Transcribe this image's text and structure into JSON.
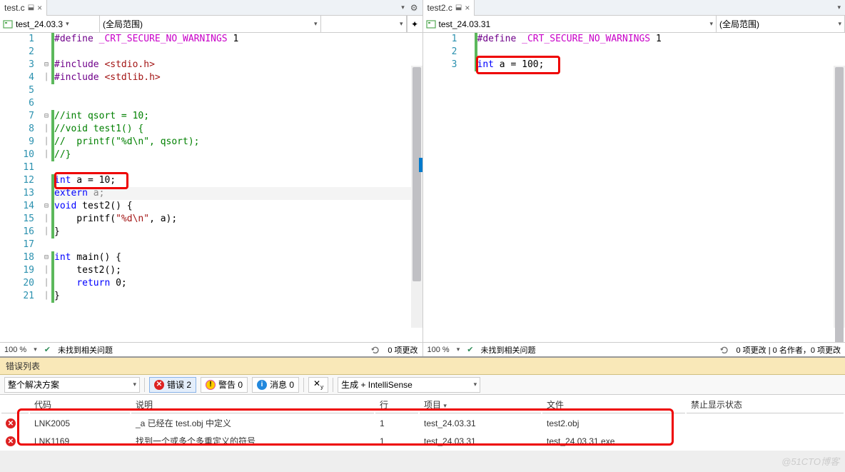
{
  "left": {
    "tab": "test.c",
    "scope1": "test_24.03.3",
    "scope2": "(全局范围)",
    "zoom": "100 %",
    "status_ok": "未找到相关问题",
    "status_changes": "0 项更改",
    "lines": {
      "l1": {
        "pre": "#define ",
        "macro": "_CRT_SECURE_NO_WARNINGS",
        "post": " 1"
      },
      "l3a": "#include ",
      "l3b": "<stdio.h>",
      "l4a": "#include ",
      "l4b": "<stdlib.h>",
      "l7": "//int qsort = 10;",
      "l8": "//void test1() {",
      "l9": "//  printf(\"%d\\n\", qsort);",
      "l10": "//}",
      "l12a": "int",
      "l12b": " a = 10;",
      "l13a": "extern",
      "l13b": " a;",
      "l14a": "void",
      "l14b": " test2() {",
      "l15a": "    printf(",
      "l15b": "\"%d\\n\"",
      "l15c": ", a);",
      "l16": "}",
      "l18a": "int",
      "l18b": " main() {",
      "l19": "    test2();",
      "l20a": "    ",
      "l20b": "return",
      "l20c": " 0;",
      "l21": "}"
    }
  },
  "right": {
    "tab": "test2.c",
    "scope1": "test_24.03.31",
    "scope2": "(全局范围)",
    "zoom": "100 %",
    "status_ok": "未找到相关问题",
    "status_changes": "0 项更改 | 0 名作者，0 项更改",
    "lines": {
      "l1": {
        "pre": "#define ",
        "macro": "_CRT_SECURE_NO_WARNINGS",
        "post": " 1"
      },
      "l3a": "int",
      "l3b": " a = 100;"
    }
  },
  "errorPanel": {
    "title": "错误列表",
    "scope": "整个解决方案",
    "errors": "错误 2",
    "warnings": "警告 0",
    "messages": "消息 0",
    "source": "生成 + IntelliSense",
    "cols": {
      "code": "代码",
      "desc": "说明",
      "line": "行",
      "project": "项目",
      "file": "文件",
      "suppress": "禁止显示状态"
    },
    "rows": [
      {
        "code": "LNK2005",
        "desc": "_a 已经在 test.obj 中定义",
        "line": "1",
        "project": "test_24.03.31",
        "file": "test2.obj"
      },
      {
        "code": "LNK1169",
        "desc": "找到一个或多个多重定义的符号",
        "line": "1",
        "project": "test_24.03.31",
        "file": "test_24.03.31.exe"
      }
    ]
  },
  "watermark": "@51CTO博客"
}
